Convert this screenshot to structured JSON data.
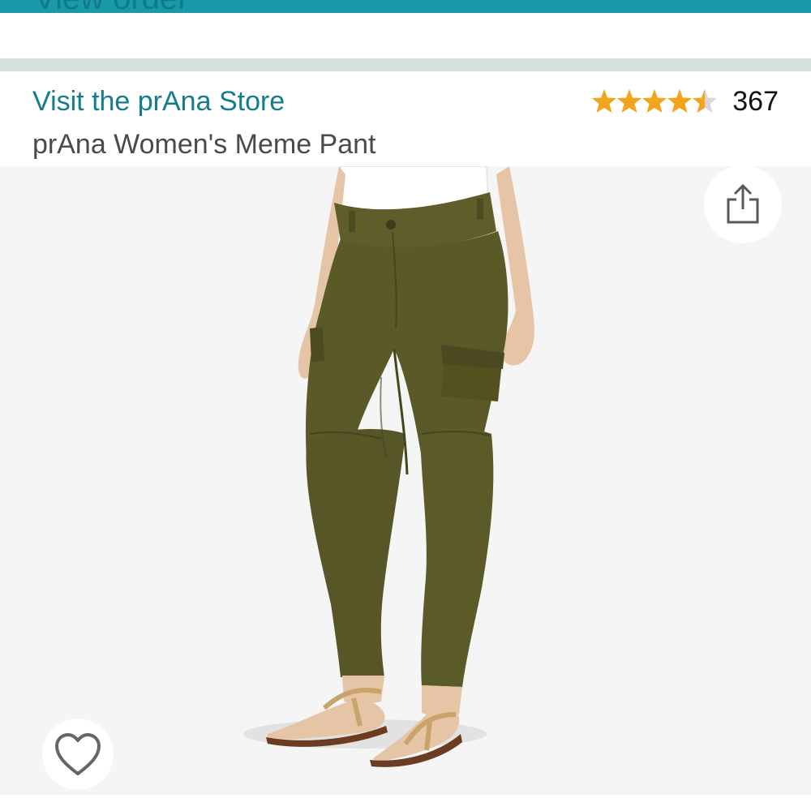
{
  "header": {
    "view_order_label": "View order"
  },
  "product": {
    "store_link": "Visit the prAna Store",
    "title": "prAna Women's Meme Pant",
    "rating": {
      "stars": 4.5,
      "count": "367"
    },
    "image": {
      "subject": "olive cargo pant on model"
    }
  },
  "icons": {
    "share": "share-icon",
    "wishlist": "heart-outline-icon",
    "star": "star-icon"
  },
  "colors": {
    "accent_bar": "#1a9aa8",
    "link": "#137d8c",
    "star": "#f2a41c",
    "title": "#4a4a4a",
    "pant": "#5a5a2a"
  }
}
